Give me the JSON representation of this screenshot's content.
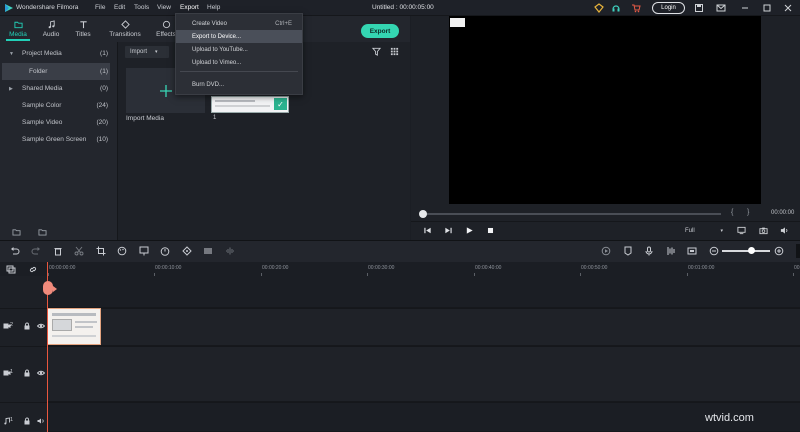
{
  "title_bar": {
    "app_name": "Wondershare Filmora",
    "menu": [
      "File",
      "Edit",
      "Tools",
      "View",
      "Export",
      "Help"
    ],
    "document_title": "Untitled : 00:00:05:00",
    "login_label": "Login"
  },
  "tabs": [
    {
      "label": "Media",
      "icon": "folder-icon"
    },
    {
      "label": "Audio",
      "icon": "music-note-icon"
    },
    {
      "label": "Titles",
      "icon": "text-icon"
    },
    {
      "label": "Transitions",
      "icon": "transitions-icon"
    },
    {
      "label": "Effects",
      "icon": "effects-icon"
    }
  ],
  "export_button": "Export",
  "export_menu": [
    {
      "label": "Create Video",
      "shortcut": "Ctrl+E"
    },
    {
      "label": "Export to Device...",
      "shortcut": ""
    },
    {
      "label": "Upload to YouTube...",
      "shortcut": ""
    },
    {
      "label": "Upload to Vimeo...",
      "shortcut": ""
    },
    {
      "label": "Burn DVD...",
      "shortcut": ""
    }
  ],
  "sidebar": [
    {
      "label": "Project Media",
      "count": "(1)",
      "caret": "▼"
    },
    {
      "label": "Folder",
      "count": "(1)",
      "caret": ""
    },
    {
      "label": "Shared Media",
      "count": "(0)",
      "caret": "▶"
    },
    {
      "label": "Sample Color",
      "count": "(24)",
      "caret": ""
    },
    {
      "label": "Sample Video",
      "count": "(20)",
      "caret": ""
    },
    {
      "label": "Sample Green Screen",
      "count": "(10)",
      "caret": ""
    }
  ],
  "media": {
    "import_dropdown": "Import",
    "import_tile_label": "Import Media",
    "clip_label": "1"
  },
  "preview": {
    "timecode": "00:00:00",
    "quality": "Full",
    "bracket_left": "{",
    "bracket_right": "}"
  },
  "ruler_ticks": [
    "00:00:00:00",
    "00:00:10:00",
    "00:00:20:00",
    "00:00:30:00",
    "00:00:40:00",
    "00:00:50:00",
    "00:01:00:00",
    "00:01:10:00"
  ],
  "tracks": [
    {
      "number": "2"
    },
    {
      "number": "1"
    },
    {
      "number": "1"
    }
  ],
  "watermark": "wtvid.com",
  "colors": {
    "accent": "#22d0b8",
    "export": "#34d6b2",
    "playhead": "#e9573f"
  }
}
